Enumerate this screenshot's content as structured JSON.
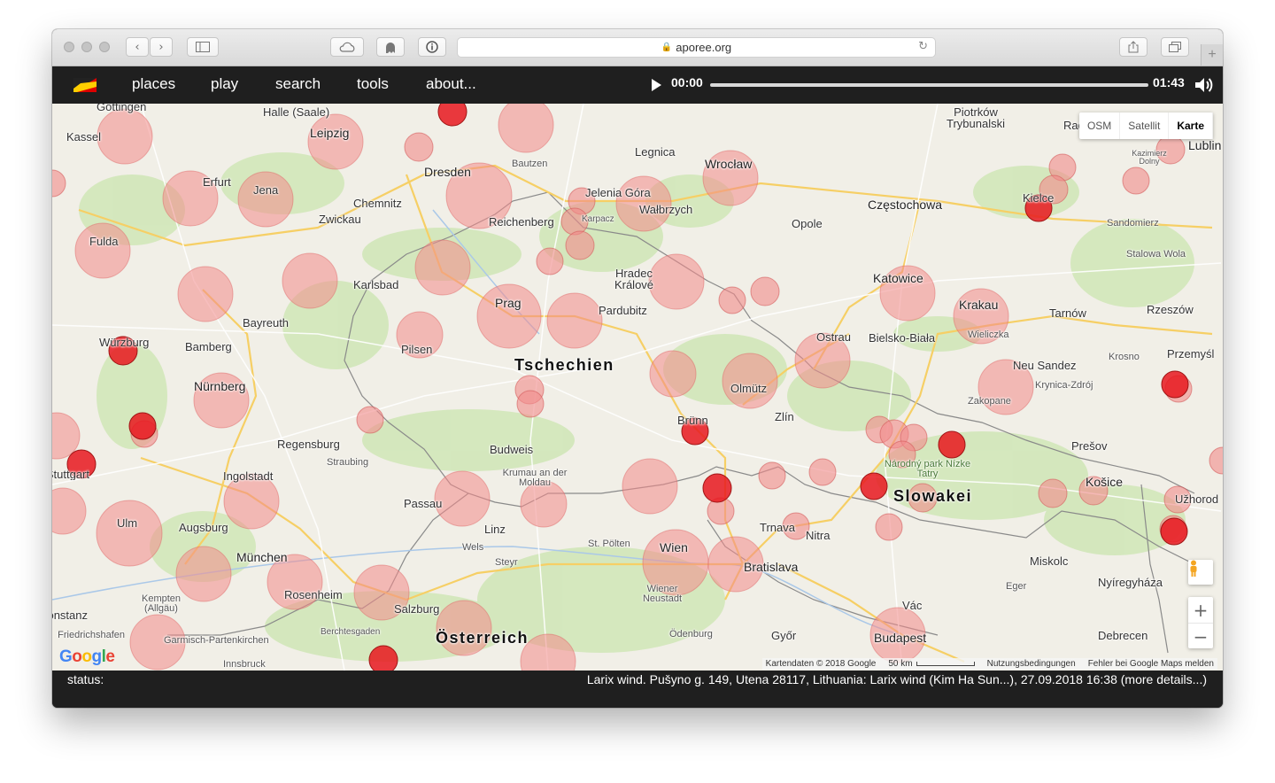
{
  "browser": {
    "url": "aporee.org"
  },
  "nav": {
    "items": [
      "places",
      "play",
      "search",
      "tools",
      "about..."
    ]
  },
  "player": {
    "current_time": "00:00",
    "duration": "01:43",
    "progress": 0
  },
  "map": {
    "type_options": [
      "OSM",
      "Satellit",
      "Karte"
    ],
    "active_type": "Karte",
    "country_labels": [
      "Tschechien",
      "Österreich",
      "Slowakei"
    ],
    "city_labels": [
      "Göttingen",
      "Halle (Saale)",
      "Leipzig",
      "Kassel",
      "Dresden",
      "Bautzen",
      "Legnica",
      "Wrocław",
      "Piotrków Trybunalski",
      "Lublin",
      "Erfurt",
      "Jena",
      "Chemnitz",
      "Zwickau",
      "Jelenia Góra",
      "Wałbrzych",
      "Reichenberg",
      "Częstochowa",
      "Kielce",
      "Opole",
      "Fulda",
      "Karlsbad",
      "Hradec Králové",
      "Pardubitz",
      "Prag",
      "Katowice",
      "Krakau",
      "Wieliczka",
      "Tarnów",
      "Rzeszów",
      "Bayreuth",
      "Bamberg",
      "Würzburg",
      "Pilsen",
      "Ostrau",
      "Bielsko-Biała",
      "Nürnberg",
      "Olmütz",
      "Neu Sandez",
      "Krynica-Zdrój",
      "Przemyśl",
      "Zakopane",
      "Brünn",
      "Zlín",
      "Regensburg",
      "Straubing",
      "Budweis",
      "Krumau an der Moldau",
      "Prešov",
      "Národný park Nízke Tatry",
      "Ingolstadt",
      "Stuttgart",
      "Passau",
      "Košice",
      "Ulm",
      "Augsburg",
      "Linz",
      "Wels",
      "Steyr",
      "St. Pölten",
      "Wien",
      "Trnava",
      "Nitra",
      "München",
      "Rosenheim",
      "Salzburg",
      "Wiener Neustadt",
      "Bratislava",
      "Miskolc",
      "Eger",
      "Nyíregyháza",
      "Kempten (Allgäu)",
      "Konstanz",
      "Friedrichshafen",
      "Garmisch-Partenkirchen",
      "Berchtesgaden",
      "Ödenburg",
      "Győr",
      "Budapest",
      "Debrecen",
      "Vác",
      "Innsbruck",
      "Stalowa Wola",
      "Sandomierz",
      "Kazimierz Dolny",
      "Krosno",
      "Radom",
      "Karpacz",
      "Užhorod"
    ],
    "attribution": {
      "data": "Kartendaten © 2018 Google",
      "scale": "50 km",
      "terms": "Nutzungsbedingungen",
      "report": "Fehler bei Google Maps melden"
    },
    "logo": "Google",
    "colors": {
      "land": "#f1efe7",
      "forest": "#cfe6b6",
      "highway": "#f6cf65",
      "marker_faded": "#f28b8b",
      "marker_active": "#e8181f"
    },
    "zoom_in": "+",
    "zoom_out": "−"
  },
  "status": {
    "label": "status:",
    "text": "Larix wind. Pušyno g. 149, Utena 28117, Lithuania: Larix wind (Kim Ha Sun...), 27.09.2018 16:38 (more details...)"
  }
}
